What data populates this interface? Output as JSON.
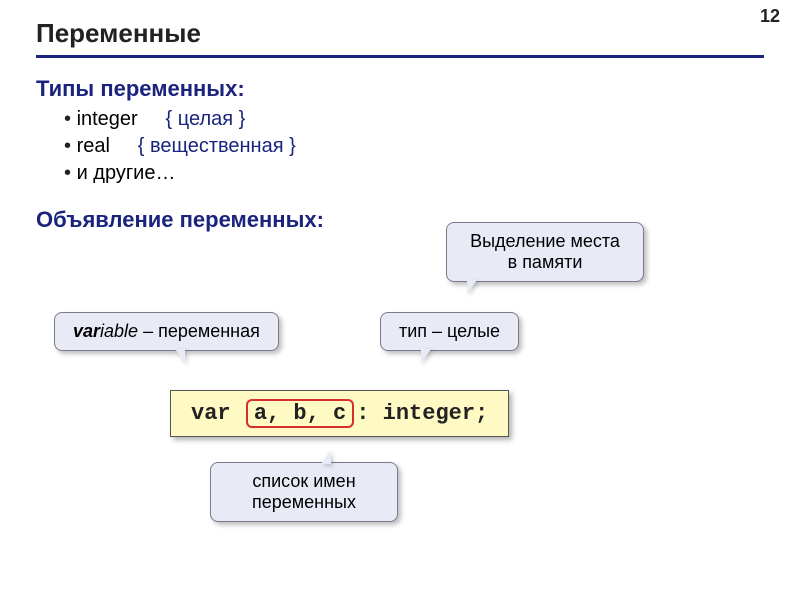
{
  "page_number": "12",
  "title": "Переменные",
  "types_heading": "Типы переменных:",
  "types": {
    "row1_name": "integer",
    "row1_comment": "{ целая }",
    "row2_name": "real",
    "row2_comment": "{ вещественная }",
    "row3_text": "и другие…"
  },
  "decl_heading": "Объявление переменных:",
  "callouts": {
    "variable_bold": "var",
    "variable_italic": "iable",
    "variable_rest": " – переменная",
    "type_text": "тип – целые",
    "memory_text": "Выделение места в памяти",
    "list_text": "список имен переменных"
  },
  "code": {
    "kw": "var ",
    "names": "a, b, c",
    "tail": ": integer;"
  }
}
